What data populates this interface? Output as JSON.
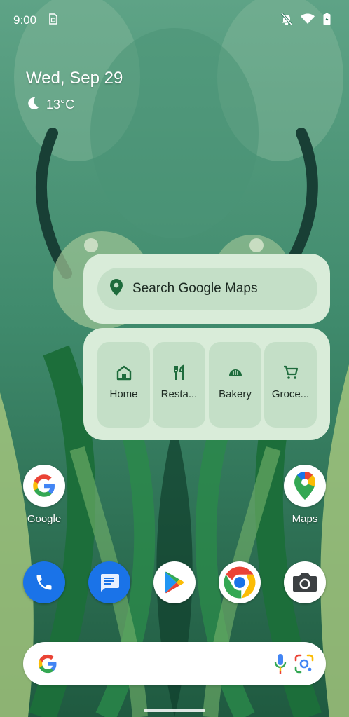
{
  "statusbar": {
    "time": "9:00",
    "icons": [
      "sim-card-icon",
      "mute-icon",
      "wifi-icon",
      "battery-icon"
    ]
  },
  "at_a_glance": {
    "date": "Wed, Sep 29",
    "weather_icon": "moon-icon",
    "temperature": "13°C"
  },
  "maps_widget": {
    "search_placeholder": "Search Google Maps",
    "shortcuts": [
      {
        "label": "Home",
        "icon": "home-icon"
      },
      {
        "label": "Resta...",
        "icon": "restaurant-icon"
      },
      {
        "label": "Bakery",
        "icon": "bakery-icon"
      },
      {
        "label": "Groce...",
        "icon": "shopping-cart-icon"
      }
    ]
  },
  "home_apps": [
    {
      "label": "Google",
      "icon": "google-icon"
    },
    {
      "label": "Maps",
      "icon": "maps-icon"
    }
  ],
  "dock": [
    "phone-icon",
    "messages-icon",
    "play-store-icon",
    "chrome-icon",
    "camera-icon"
  ],
  "colors": {
    "widget_bg": "#d9ecd9",
    "widget_pill": "#c4dfc7",
    "accent_green": "#1e6b3c"
  }
}
